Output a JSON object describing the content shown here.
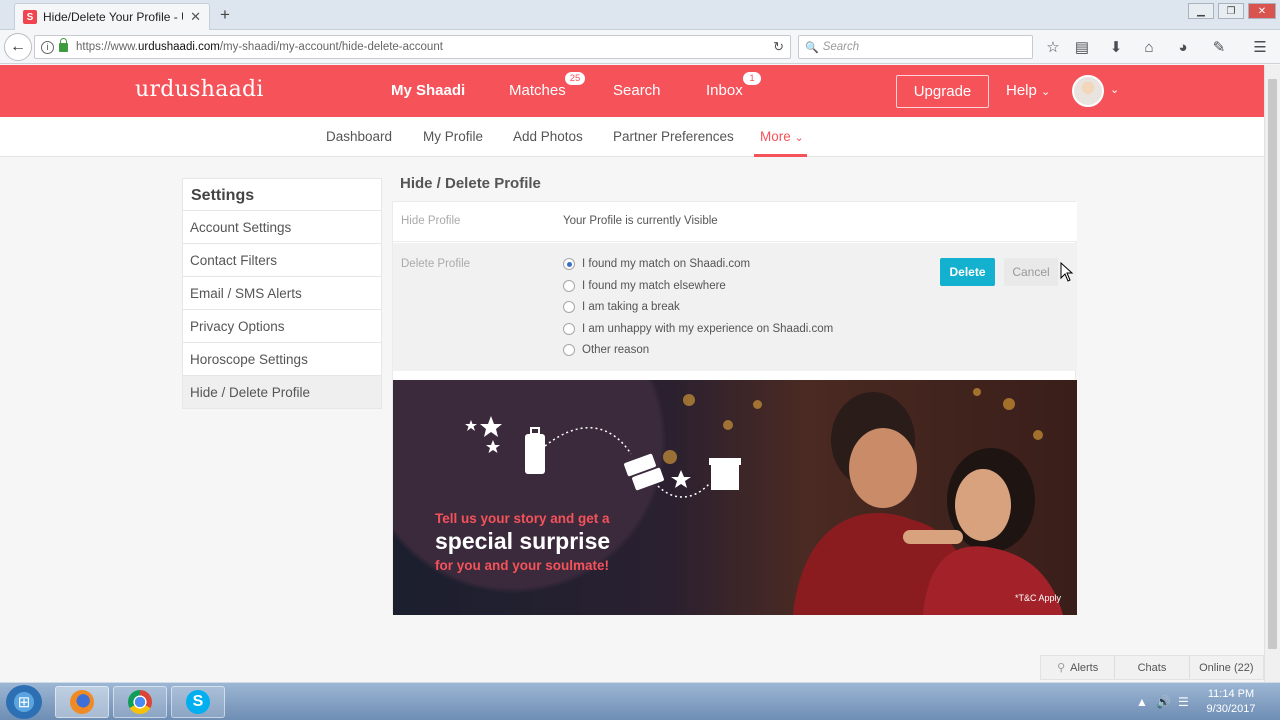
{
  "browser": {
    "tab_title": "Hide/Delete Your Profile - Ur",
    "favicon_letter": "S",
    "url_prefix": "https://www.",
    "url_domain": "urdushaadi.com",
    "url_path": "/my-shaadi/my-account/hide-delete-account",
    "search_placeholder": "Search"
  },
  "site": {
    "logo": "urdushaadi",
    "nav": {
      "my_shaadi": "My Shaadi",
      "matches": "Matches",
      "matches_badge": "25",
      "search": "Search",
      "inbox": "Inbox",
      "inbox_badge": "1",
      "upgrade": "Upgrade",
      "help": "Help"
    },
    "subnav": {
      "dashboard": "Dashboard",
      "my_profile": "My Profile",
      "add_photos": "Add Photos",
      "partner_preferences": "Partner Preferences",
      "more": "More"
    },
    "accent_color": "#f5525a"
  },
  "sidebar": {
    "title": "Settings",
    "items": [
      {
        "label": "Account Settings"
      },
      {
        "label": "Contact Filters"
      },
      {
        "label": "Email / SMS Alerts"
      },
      {
        "label": "Privacy Options"
      },
      {
        "label": "Horoscope Settings"
      },
      {
        "label": "Hide / Delete Profile"
      }
    ]
  },
  "main": {
    "title": "Hide / Delete Profile",
    "hide_label": "Hide Profile",
    "hide_status": "Your Profile is currently Visible",
    "delete_label": "Delete Profile",
    "reasons": [
      {
        "label": "I found my match on Shaadi.com",
        "checked": true
      },
      {
        "label": "I found my match elsewhere",
        "checked": false
      },
      {
        "label": "I am taking a break",
        "checked": false
      },
      {
        "label": "I am unhappy with my experience on Shaadi.com",
        "checked": false
      },
      {
        "label": "Other reason",
        "checked": false
      }
    ],
    "delete_button": "Delete",
    "cancel_button": "Cancel",
    "delete_color": "#13b1cf"
  },
  "banner": {
    "line1": "Tell us your story and get a",
    "line2": "special surprise",
    "line3": "for you and your soulmate!",
    "tc": "*T&C Apply"
  },
  "footer_bar": {
    "alerts": "Alerts",
    "chats": "Chats",
    "online": "Online (22)"
  },
  "taskbar": {
    "time": "11:14 PM",
    "date": "9/30/2017"
  }
}
